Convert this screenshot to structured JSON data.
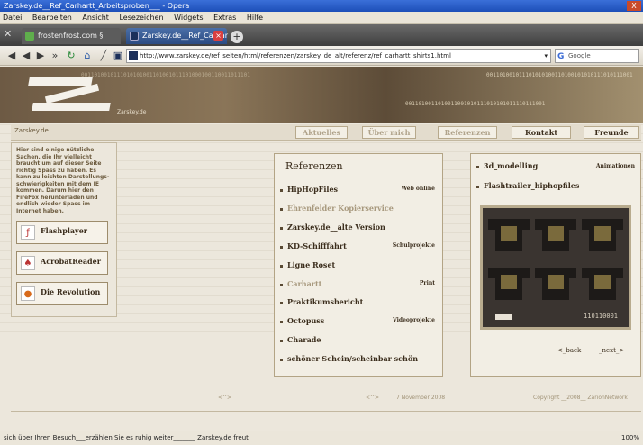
{
  "window": {
    "title": "Zarskey.de__Ref_Carhartt_Arbeitsproben___ - Opera",
    "close_label": "X"
  },
  "menu": [
    "Datei",
    "Bearbeiten",
    "Ansicht",
    "Lesezeichen",
    "Widgets",
    "Extras",
    "Hilfe"
  ],
  "tabs": [
    {
      "label": "frostenfrost.com §"
    },
    {
      "label": "Zarskey.de__Ref_Carhar"
    }
  ],
  "address": {
    "url": "http://www.zarskey.de/ref_seiten/html/referenzen/zarskey_de_alt/referenz/ref_carhartt_shirts1.html",
    "search_placeholder": "Google"
  },
  "banner": {
    "binary_top": "0011010010111010101001101001011101000100110011011101",
    "binary_right": "001101001011101010100110100101010111010111001",
    "binary_mid": "0011010011010011001010111010101011110111001",
    "brand": "Zarskey.de"
  },
  "subheader": {
    "site": "Zarskey.de",
    "nav": [
      "Aktuelles",
      "Über mich",
      "Referenzen",
      "Kontakt",
      "Freunde"
    ]
  },
  "left": {
    "intro": "Hier sind einige nützliche Sachen, die Ihr vielleicht braucht um auf dieser Seite richtig Spass zu haben. Es kann zu leichten Darstellungs-schwierigkeiten mit dem IE kommen. Darum hier den FireFox herunterladen und endlich wieder Spass im Internet haben.",
    "buttons": [
      "Flashplayer",
      "AcrobatReader",
      "Die Revolution"
    ]
  },
  "referenzen": {
    "title": "Referenzen",
    "items": [
      {
        "label": "HipHopFiles",
        "tag": "Web online"
      },
      {
        "label": "Ehrenfelder Kopierservice",
        "tag": ""
      },
      {
        "label": "Zarskey.de__alte Version",
        "tag": ""
      },
      {
        "label": "KD-Schifffahrt",
        "tag": "Schulprojekte"
      },
      {
        "label": "Ligne Roset",
        "tag": ""
      },
      {
        "label": "Carhartt",
        "tag": "Print"
      },
      {
        "label": "Praktikumsbericht",
        "tag": ""
      },
      {
        "label": "Octopuss",
        "tag": "Videoprojekte"
      },
      {
        "label": "Charade",
        "tag": ""
      },
      {
        "label": "schöner Schein/scheinbar schön",
        "tag": ""
      }
    ]
  },
  "right": {
    "items": [
      "3d_modelling",
      "Flashtrailer_hiphopfiles"
    ],
    "tag": "Animationen",
    "photo_code": "110110001",
    "back": "<_back",
    "next": "_next_>"
  },
  "footer": {
    "left": "<^>",
    "mid_arrow": "<^>",
    "date": "7 November 2008",
    "copyright": "Copyright __2008__ ZarionNetwork"
  },
  "status": {
    "text": "sich über Ihren Besuch___erzählen Sie es ruhig weiter_______ Zarskey.de freut",
    "zoom": "100%"
  }
}
